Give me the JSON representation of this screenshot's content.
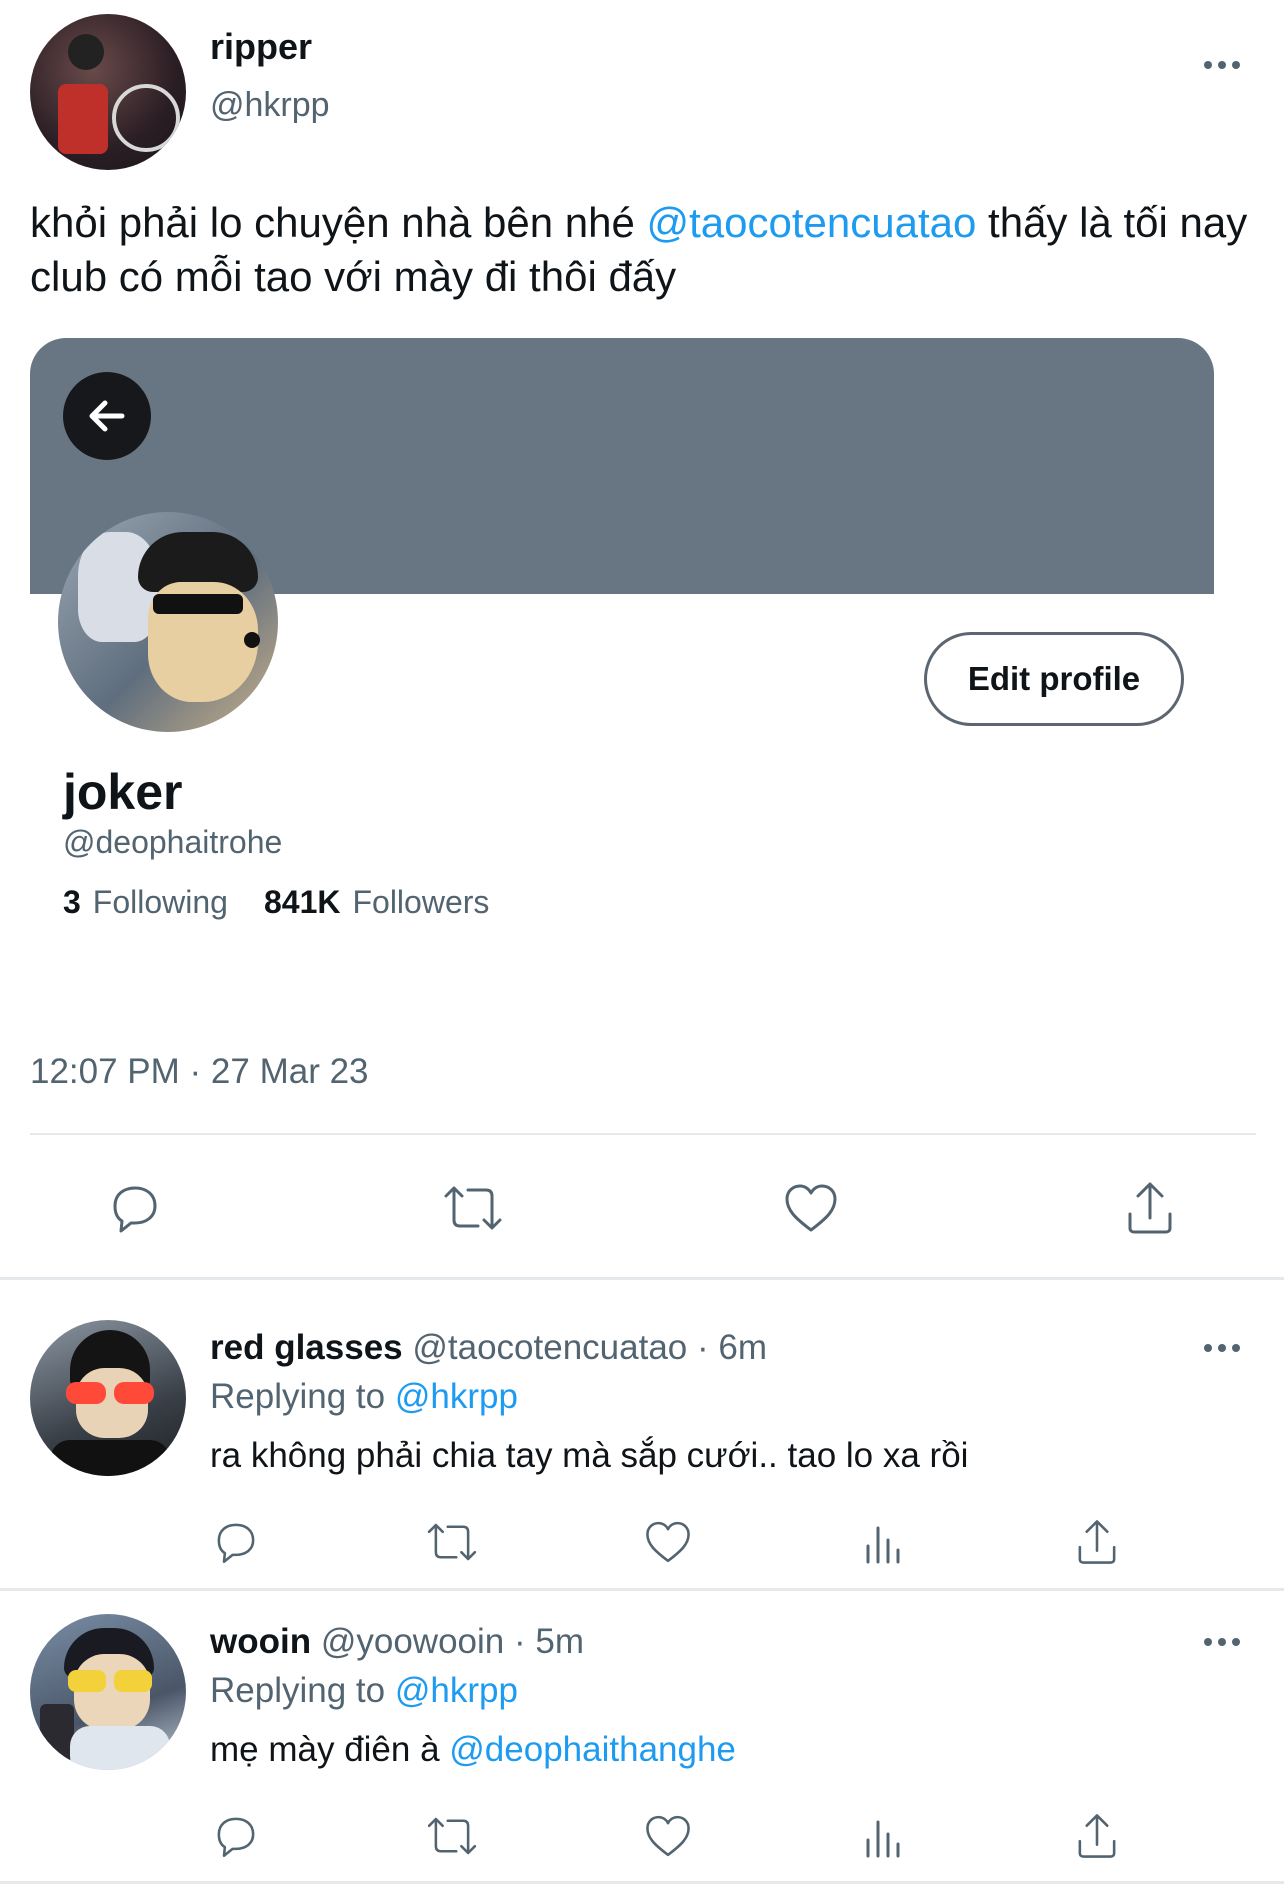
{
  "main_tweet": {
    "author_name": "ripper",
    "author_handle": "@hkrpp",
    "text_before": "khỏi phải lo chuyện nhà bên nhé ",
    "mention": "@taocotencuatao",
    "text_after": " thấy là tối nay club có mỗi tao với mày đi thôi đấy",
    "timestamp": "12:07 PM · 27 Mar 23"
  },
  "embedded_profile": {
    "name": "joker",
    "handle": "@deophaitrohe",
    "edit_button": "Edit profile",
    "following_count": "3",
    "following_label": "Following",
    "followers_count": "841K",
    "followers_label": "Followers",
    "banner_color": "#687684"
  },
  "replies": [
    {
      "name": "red glasses",
      "handle": "@taocotencuatao",
      "time": "· 6m",
      "replying_label": "Replying to",
      "replying_to": "@hkrpp",
      "text": "ra không phải chia tay mà sắp cưới.. tao lo xa rồi",
      "mention": ""
    },
    {
      "name": "wooin",
      "handle": "@yoowooin",
      "time": "· 5m",
      "replying_label": "Replying to",
      "replying_to": "@hkrpp",
      "text": "mẹ mày điên à ",
      "mention": "@deophaithanghe"
    }
  ],
  "colors": {
    "accent": "#1d9bf0",
    "muted": "#536471",
    "text": "#0f1419"
  },
  "icons": [
    "reply-icon",
    "retweet-icon",
    "like-icon",
    "share-icon",
    "views-icon",
    "more-icon",
    "back-arrow-icon"
  ]
}
